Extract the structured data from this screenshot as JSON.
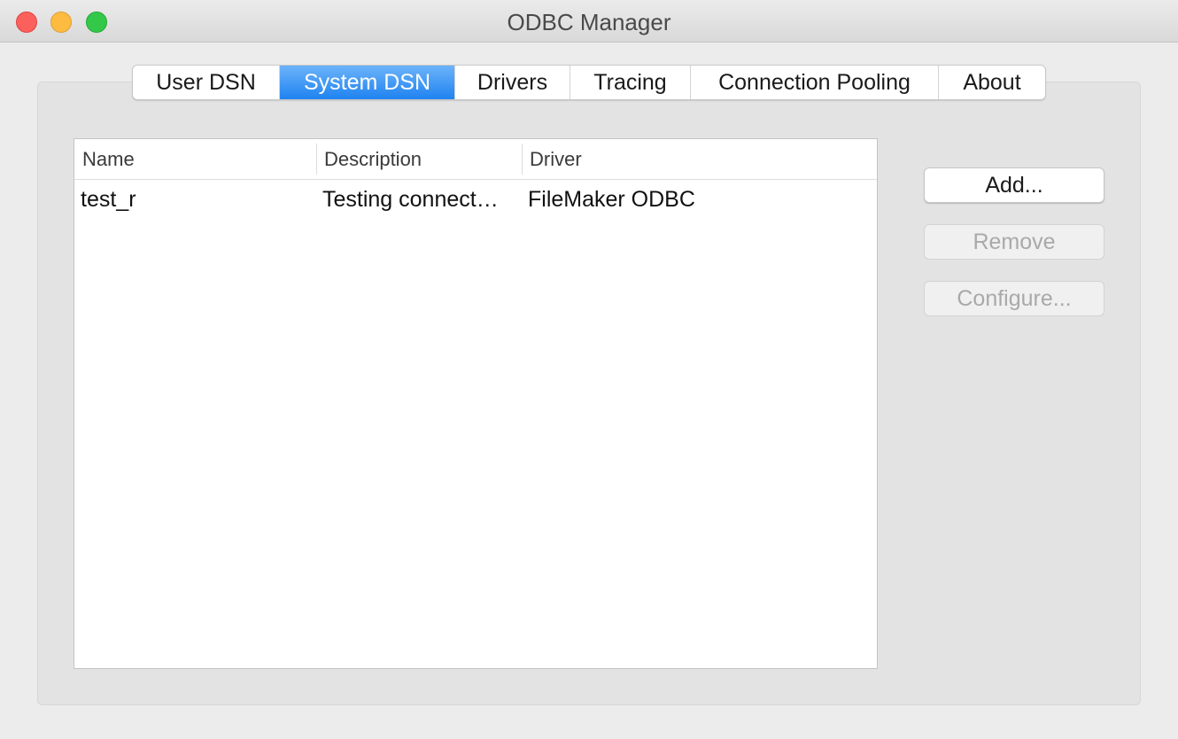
{
  "window": {
    "title": "ODBC Manager"
  },
  "tabs": [
    {
      "label": "User DSN",
      "selected": false
    },
    {
      "label": "System DSN",
      "selected": true
    },
    {
      "label": "Drivers",
      "selected": false
    },
    {
      "label": "Tracing",
      "selected": false
    },
    {
      "label": "Connection Pooling",
      "selected": false
    },
    {
      "label": "About",
      "selected": false
    }
  ],
  "table": {
    "columns": [
      "Name",
      "Description",
      "Driver"
    ],
    "rows": [
      [
        "test_r",
        "Testing connect…",
        "FileMaker ODBC"
      ]
    ]
  },
  "buttons": {
    "add": {
      "label": "Add...",
      "enabled": true
    },
    "remove": {
      "label": "Remove",
      "enabled": false
    },
    "configure": {
      "label": "Configure...",
      "enabled": false
    }
  },
  "colors": {
    "selected_tab": "#1f83f0",
    "close": "#fc605c",
    "minimize": "#fdbc40",
    "maximize": "#34c84a"
  }
}
